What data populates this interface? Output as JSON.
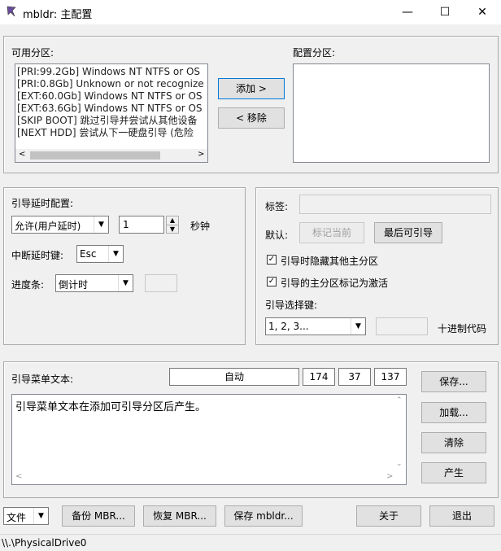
{
  "window": {
    "title": "mbldr: 主配置",
    "minimize": "—",
    "maximize": "☐",
    "close": "✕"
  },
  "available": {
    "label": "可用分区:",
    "items": [
      "[PRI:99.2Gb] Windows NT NTFS or OS",
      "[PRI:0.8Gb] Unknown or not recognize",
      "[EXT:60.0Gb] Windows NT NTFS or OS",
      "[EXT:63.6Gb] Windows NT NTFS or OS",
      "[SKIP BOOT] 跳过引导并尝试从其他设备",
      "[NEXT HDD] 尝试从下一硬盘引导 (危险"
    ]
  },
  "configured": {
    "label": "配置分区:"
  },
  "buttons": {
    "add": "添加 >",
    "remove": "< 移除"
  },
  "delay": {
    "label": "引导延时配置:",
    "mode_value": "允许(用户延时)",
    "seconds_value": "1",
    "seconds_unit": "秒钟",
    "interrupt_label": "中断延时键:",
    "interrupt_value": "Esc",
    "progress_label": "进度条:",
    "progress_value": "倒计时"
  },
  "tag": {
    "label": "标签:",
    "default_label": "默认:",
    "mark_current": "标记当前",
    "last_bootable": "最后可引导",
    "hide_other": "引导时隐藏其他主分区",
    "mark_active": "引导的主分区标记为激活",
    "select_key_label": "引导选择键:",
    "select_key_value": "1, 2, 3...",
    "hex_code": "十进制代码",
    "check": "✓"
  },
  "menu_text": {
    "label": "引导菜单文本:",
    "auto": "自动",
    "r": "174",
    "g": "37",
    "b": "137",
    "content": "引导菜单文本在添加可引导分区后产生。",
    "save": "保存...",
    "load": "加载...",
    "clear": "清除",
    "generate": "产生"
  },
  "bottom": {
    "file": "文件",
    "backup": "备份 MBR...",
    "restore": "恢复 MBR...",
    "save_mbldr": "保存 mbldr...",
    "about": "关于",
    "exit": "退出"
  },
  "status": {
    "path": "\\\\.\\PhysicalDrive0"
  }
}
